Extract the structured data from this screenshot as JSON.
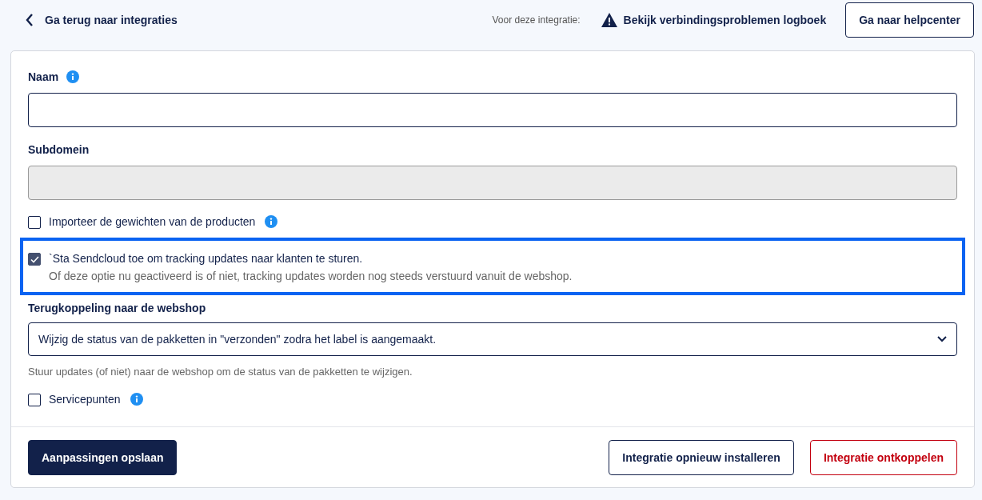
{
  "header": {
    "back_link": "Ga terug naar integraties",
    "context_label": "Voor deze integratie:",
    "log_link": "Bekijk verbindingsproblemen logboek",
    "help_button": "Ga naar helpcenter"
  },
  "form": {
    "items": [
      {
        "kind": "text_field",
        "label": "Naam",
        "info": true,
        "disabled": false
      },
      {
        "kind": "text_field",
        "label": "Subdomein",
        "info": false,
        "disabled": true
      },
      {
        "kind": "checkbox",
        "label": "Importeer de gewichten van de producten",
        "info": true,
        "checked": false,
        "highlighted": false
      },
      {
        "kind": "checkbox",
        "label": "`Sta Sendcloud toe om tracking updates naar klanten te sturen.",
        "description": "Of deze optie nu geactiveerd is of niet, tracking updates worden nog steeds verstuurd vanuit de webshop.",
        "info": false,
        "checked": true,
        "highlighted": true
      },
      {
        "kind": "select",
        "label": "Terugkoppeling naar de webshop",
        "value": "Wijzig de status van de pakketten in \"verzonden\" zodra het label is aangemaakt.",
        "hint": "Stuur updates (of niet) naar de webshop om de status van de pakketten te wijzigen."
      },
      {
        "kind": "checkbox",
        "label": "Servicepunten",
        "info": true,
        "checked": false,
        "highlighted": false
      }
    ]
  },
  "footer": {
    "save_button": "Aanpassingen opslaan",
    "reinstall_button": "Integratie opnieuw installeren",
    "disconnect_button": "Integratie ontkoppelen"
  }
}
